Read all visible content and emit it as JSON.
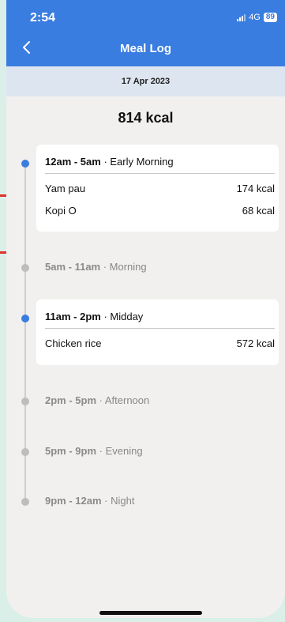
{
  "status": {
    "time": "2:54",
    "network": "4G",
    "battery": "89"
  },
  "header": {
    "title": "Meal Log",
    "back_icon": "chevron-left-icon"
  },
  "date": "17 Apr 2023",
  "total": "814 kcal",
  "colors": {
    "accent": "#3a7de0",
    "inactive_dot": "#bdbdbd"
  },
  "slots": [
    {
      "range": "12am - 5am",
      "name": "Early Morning",
      "active": true,
      "items": [
        {
          "name": "Yam pau",
          "kcal": "174 kcal"
        },
        {
          "name": "Kopi O",
          "kcal": "68 kcal"
        }
      ]
    },
    {
      "range": "5am - 11am",
      "name": "Morning",
      "active": false,
      "items": []
    },
    {
      "range": "11am - 2pm",
      "name": "Midday",
      "active": true,
      "items": [
        {
          "name": "Chicken rice",
          "kcal": "572 kcal"
        }
      ]
    },
    {
      "range": "2pm - 5pm",
      "name": "Afternoon",
      "active": false,
      "items": []
    },
    {
      "range": "5pm - 9pm",
      "name": "Evening",
      "active": false,
      "items": []
    },
    {
      "range": "9pm - 12am",
      "name": "Night",
      "active": false,
      "items": []
    }
  ]
}
